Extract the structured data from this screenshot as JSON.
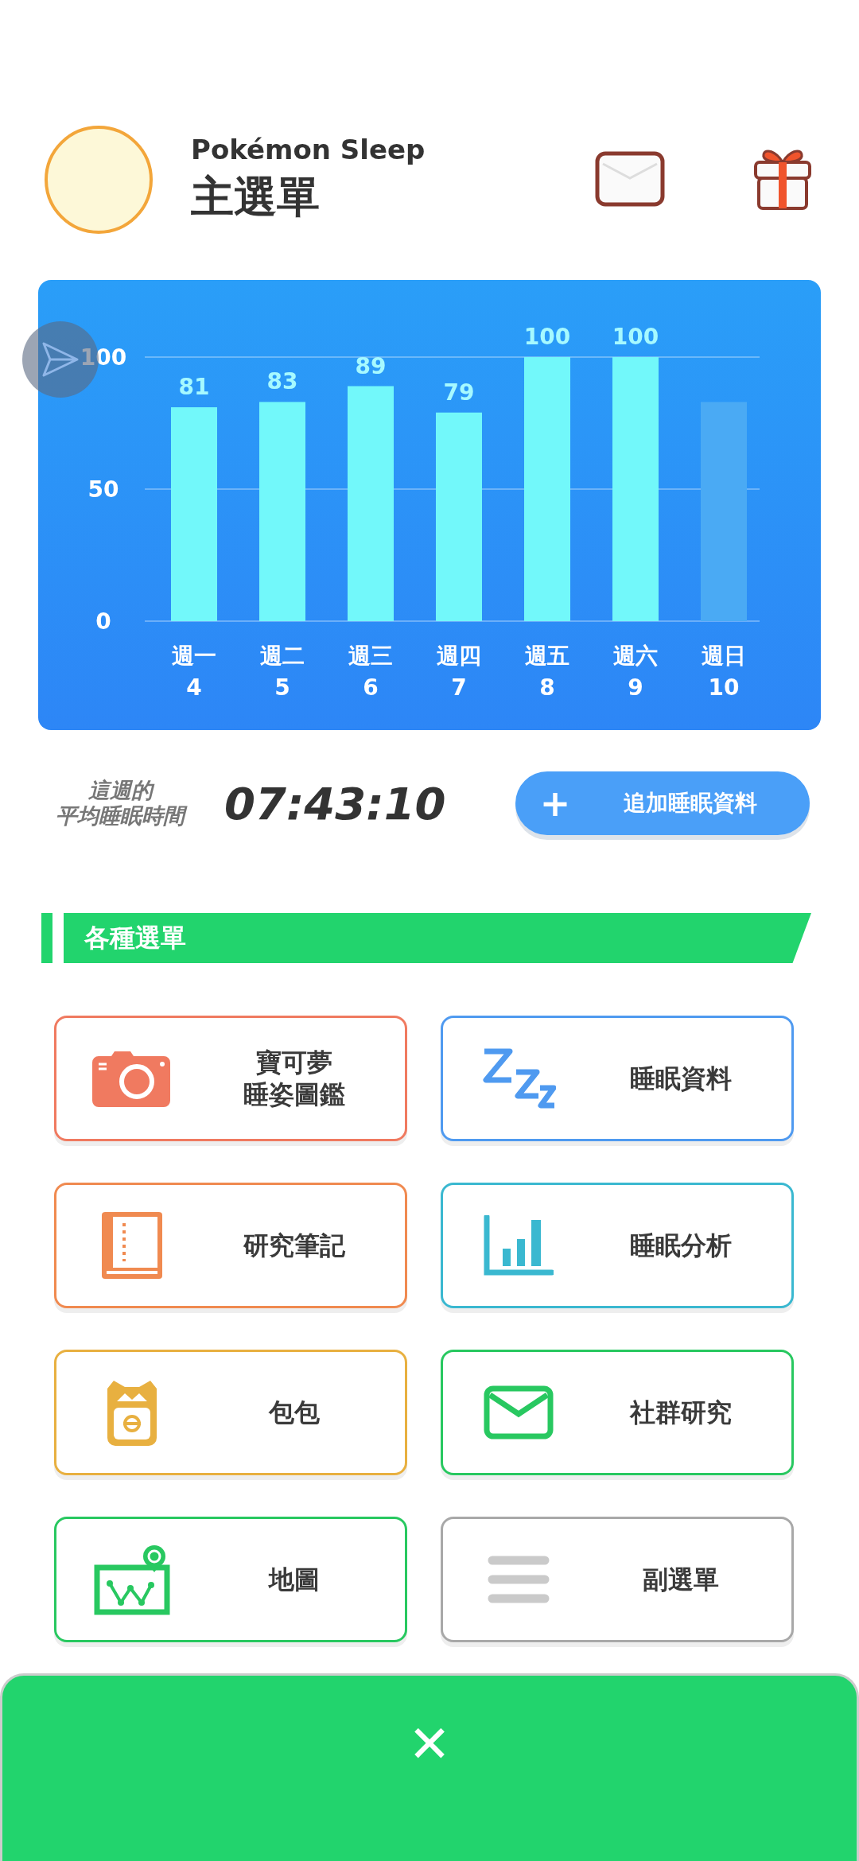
{
  "header": {
    "app_name": "Pokémon Sleep",
    "title": "主選單"
  },
  "sleep_chart": {
    "chart_data": {
      "type": "bar",
      "categories": [
        "週一",
        "週二",
        "週三",
        "週四",
        "週五",
        "週六",
        "週日"
      ],
      "ylim": [
        0,
        100
      ],
      "yticks": [
        0,
        50,
        100
      ],
      "stacked": true,
      "series": [
        {
          "color": "#72f8fa",
          "values": [
            81,
            83,
            89,
            79,
            100,
            100,
            null
          ]
        },
        {
          "color": "#4aaaf4",
          "values": [
            null,
            null,
            null,
            null,
            null,
            null,
            83
          ]
        }
      ],
      "value_labels": [
        "81",
        "83",
        "89",
        "79",
        "100",
        "100",
        null
      ]
    },
    "dates": [
      "4",
      "5",
      "6",
      "7",
      "8",
      "9",
      "10"
    ]
  },
  "average": {
    "label_lines": [
      "這週的",
      "平均睡眠時間"
    ],
    "time": "07:43:10",
    "add_button": {
      "icon": "+",
      "label": "追加睡眠資料"
    }
  },
  "section": {
    "title": "各種選單"
  },
  "menu": [
    {
      "kind": "camera",
      "color": "#f07a60",
      "lines": [
        "寶可夢",
        "睡姿圖鑑"
      ]
    },
    {
      "kind": "zzz",
      "color": "#4f9af0",
      "lines": [
        "睡眠資料"
      ]
    },
    {
      "kind": "book",
      "color": "#f08a50",
      "lines": [
        "研究筆記"
      ]
    },
    {
      "kind": "chart",
      "color": "#3ab8d0",
      "lines": [
        "睡眠分析"
      ]
    },
    {
      "kind": "bag",
      "color": "#e8b040",
      "lines": [
        "包包"
      ]
    },
    {
      "kind": "mail",
      "color": "#28c860",
      "lines": [
        "社群研究"
      ]
    },
    {
      "kind": "map",
      "color": "#28c860",
      "lines": [
        "地圖"
      ]
    },
    {
      "kind": "lines",
      "color": "#a8a8a8",
      "lines": [
        "副選單"
      ]
    }
  ],
  "close_sheet": {
    "icon": "✕"
  }
}
